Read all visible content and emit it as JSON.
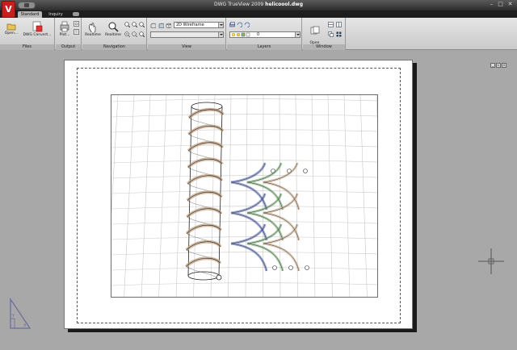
{
  "window": {
    "logo_letter": "V",
    "title_app": "DWG TrueView 2009",
    "title_file": "helicoool.dwg",
    "controls": {
      "minimize": "–",
      "maximize": "□",
      "close": "✕"
    }
  },
  "tabs": [
    {
      "label": "Standard",
      "active": true
    },
    {
      "label": "Inquiry",
      "active": false
    }
  ],
  "ribbon": {
    "files": {
      "title": "Files",
      "open_label": "Open...",
      "convert_label": "DWG Convert..."
    },
    "output": {
      "title": "Output",
      "plot_label": "Plot..."
    },
    "navigation": {
      "title": "Navigation",
      "pan_label": "Realtime",
      "zoom_label": "Realtime"
    },
    "view": {
      "title": "View",
      "visual_style": "2D Wireframe",
      "named_view": ""
    },
    "layers": {
      "title": "Layers",
      "current_layer": "0"
    },
    "window": {
      "title": "Window",
      "open_drawings_label": "Open\nDrawings"
    }
  },
  "doc_controls": {
    "minimize": "_",
    "restore": "▫",
    "close": "x"
  },
  "icons": [
    "app-logo-icon",
    "open-icon",
    "dwg-convert-icon",
    "plot-icon",
    "pan-icon",
    "zoom-icon",
    "cube-icon",
    "layer-bulb-icon",
    "open-drawings-icon",
    "ucs-icon",
    "crosshair-icon"
  ],
  "colors": {
    "helix_wire": "#222222",
    "coil_tan": "#c4a484",
    "coil_blue": "#4d5fb0",
    "coil_green": "#6ea86a",
    "grid": "#c9c9c9"
  }
}
